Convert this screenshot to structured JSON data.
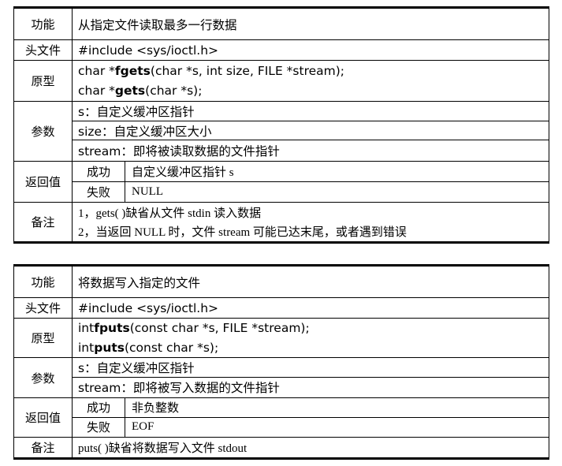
{
  "table1": {
    "function_label": "功能",
    "function_value": "从指定文件读取最多一行数据",
    "header_label": "头文件",
    "header_value": "#include <sys/ioctl.h>",
    "prototype_label": "原型",
    "prototype_lines": [
      {
        "pre": "char *",
        "name": "fgets",
        "post": "(char *s, int size, FILE *stream);"
      },
      {
        "pre": "char *",
        "name": "gets",
        "post": "(char *s);"
      }
    ],
    "params_label": "参数",
    "params": [
      "s：自定义缓冲区指针",
      "size：自定义缓冲区大小",
      "stream：即将被读取数据的文件指针"
    ],
    "return_label": "返回值",
    "returns": [
      {
        "key": "成功",
        "value": "自定义缓冲区指针 s"
      },
      {
        "key": "失败",
        "value": "NULL"
      }
    ],
    "notes_label": "备注",
    "notes": [
      "1，gets( )缺省从文件 stdin 读入数据",
      "2，当返回 NULL 时，文件 stream 可能已达末尾，或者遇到错误"
    ]
  },
  "table2": {
    "function_label": "功能",
    "function_value": "将数据写入指定的文件",
    "header_label": "头文件",
    "header_value": "#include <sys/ioctl.h>",
    "prototype_label": "原型",
    "prototype_lines": [
      {
        "pre": "int ",
        "name": "fputs",
        "post": "(const char *s, FILE *stream);"
      },
      {
        "pre": "int ",
        "name": "puts",
        "post": "(const char *s);"
      }
    ],
    "params_label": "参数",
    "params": [
      "s：自定义缓冲区指针",
      "stream：即将被写入数据的文件指针"
    ],
    "return_label": "返回值",
    "returns": [
      {
        "key": "成功",
        "value": "非负整数"
      },
      {
        "key": "失败",
        "value": "EOF"
      }
    ],
    "notes_label": "备注",
    "notes": [
      "puts( )缺省将数据写入文件 stdout"
    ]
  }
}
